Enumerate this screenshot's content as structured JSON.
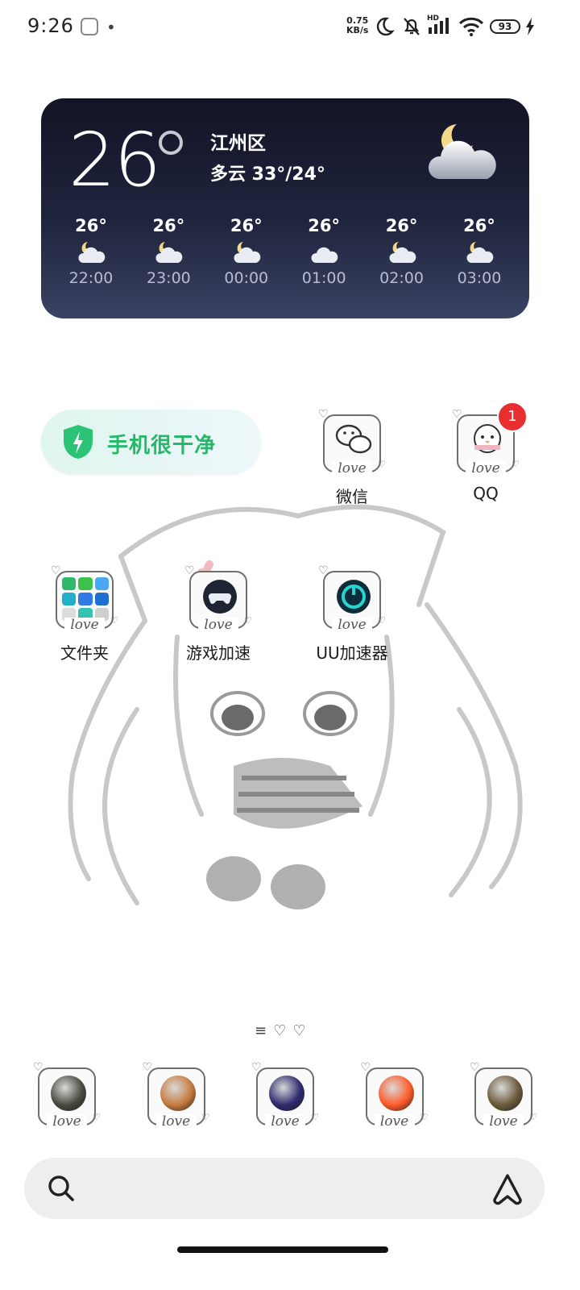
{
  "status_bar": {
    "time": "9:26",
    "net_speed_value": "0.75",
    "net_speed_unit": "KB/s",
    "signal_tag": "HD",
    "battery": "93"
  },
  "weather": {
    "temperature": "26",
    "location": "江州区",
    "description": "多云  33°/24°",
    "hourly": [
      {
        "temp": "26°",
        "time": "22:00",
        "icon": "partly-cloudy-night-icon"
      },
      {
        "temp": "26°",
        "time": "23:00",
        "icon": "partly-cloudy-night-icon"
      },
      {
        "temp": "26°",
        "time": "00:00",
        "icon": "partly-cloudy-night-icon"
      },
      {
        "temp": "26°",
        "time": "01:00",
        "icon": "cloud-icon"
      },
      {
        "temp": "26°",
        "time": "02:00",
        "icon": "partly-cloudy-night-icon"
      },
      {
        "temp": "26°",
        "time": "03:00",
        "icon": "partly-cloudy-night-icon"
      }
    ]
  },
  "clean_widget": {
    "label": "手机很干净",
    "color": "#25b86a"
  },
  "apps": {
    "wechat": {
      "label": "微信"
    },
    "qq": {
      "label": "QQ",
      "badge": "1"
    },
    "folder": {
      "label": "文件夹"
    },
    "game_boost": {
      "label": "游戏加速"
    },
    "uu": {
      "label": "UU加速器"
    }
  },
  "icon_frame_text": "love",
  "dock": [
    {
      "name": "dock-app-1",
      "icon": "soldier-game-icon"
    },
    {
      "name": "dock-app-2",
      "icon": "dont-starve-icon"
    },
    {
      "name": "dock-app-3",
      "icon": "cube-game-icon"
    },
    {
      "name": "dock-app-4",
      "icon": "kuaishou-icon"
    },
    {
      "name": "dock-app-5",
      "icon": "battle-game-icon"
    }
  ],
  "pager": {
    "menu_glyph": "≡",
    "dots": "♡♡"
  },
  "search": {
    "placeholder": ""
  }
}
